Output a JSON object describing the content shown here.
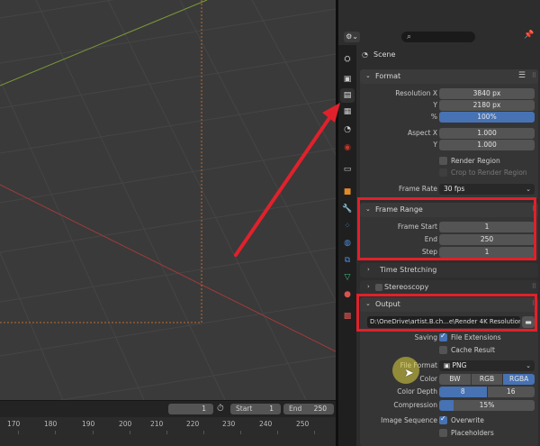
{
  "colors": {
    "accent": "#4772b3",
    "highlight": "#e0212b",
    "panel": "#353535",
    "field": "#545454"
  },
  "timeline": {
    "current_frame": "1",
    "start_label": "Start",
    "start_value": "1",
    "end_label": "End",
    "end_value": "250",
    "ticks": [
      "170",
      "180",
      "190",
      "200",
      "210",
      "220",
      "230",
      "240",
      "250"
    ]
  },
  "header": {
    "editor_icon": "properties-icon",
    "search_icon": "search-icon",
    "pin_icon": "pin-icon"
  },
  "tabs": [
    "tool",
    "render",
    "output",
    "view-layer",
    "scene",
    "world",
    "collection",
    "object",
    "modifiers",
    "particles",
    "physics",
    "constraints",
    "data",
    "material",
    "texture"
  ],
  "scene_label": "Scene",
  "format": {
    "title": "Format",
    "resolution_x_label": "Resolution X",
    "resolution_x": "3840 px",
    "y_label": "Y",
    "resolution_y": "2180 px",
    "percent_label": "%",
    "percent": "100%",
    "aspect_x_label": "Aspect X",
    "aspect_x": "1.000",
    "aspect_y_label": "Y",
    "aspect_y": "1.000",
    "render_region": "Render Region",
    "crop_region": "Crop to Render Region",
    "frame_rate_label": "Frame Rate",
    "frame_rate": "30 fps"
  },
  "frame_range": {
    "title": "Frame Range",
    "start_label": "Frame Start",
    "start": "1",
    "end_label": "End",
    "end": "250",
    "step_label": "Step",
    "step": "1"
  },
  "time_stretching": {
    "title": "Time Stretching"
  },
  "stereoscopy": {
    "title": "Stereoscopy"
  },
  "output": {
    "title": "Output",
    "path": "D:\\OneDrive\\artist.B.ch...e\\Render 4K Resolution\\",
    "saving_label": "Saving",
    "file_extensions": "File Extensions",
    "cache_result": "Cache Result",
    "file_format_label": "File Format",
    "file_format": "PNG",
    "color_label": "Color",
    "color_options": [
      "BW",
      "RGB",
      "RGBA"
    ],
    "color_selected": "RGBA",
    "color_depth_label": "Color Depth",
    "color_depth_options": [
      "8",
      "16"
    ],
    "color_depth_selected": "8",
    "compression_label": "Compression",
    "compression": "15%",
    "image_sequence_label": "Image Sequence",
    "overwrite": "Overwrite",
    "placeholders": "Placeholders"
  }
}
